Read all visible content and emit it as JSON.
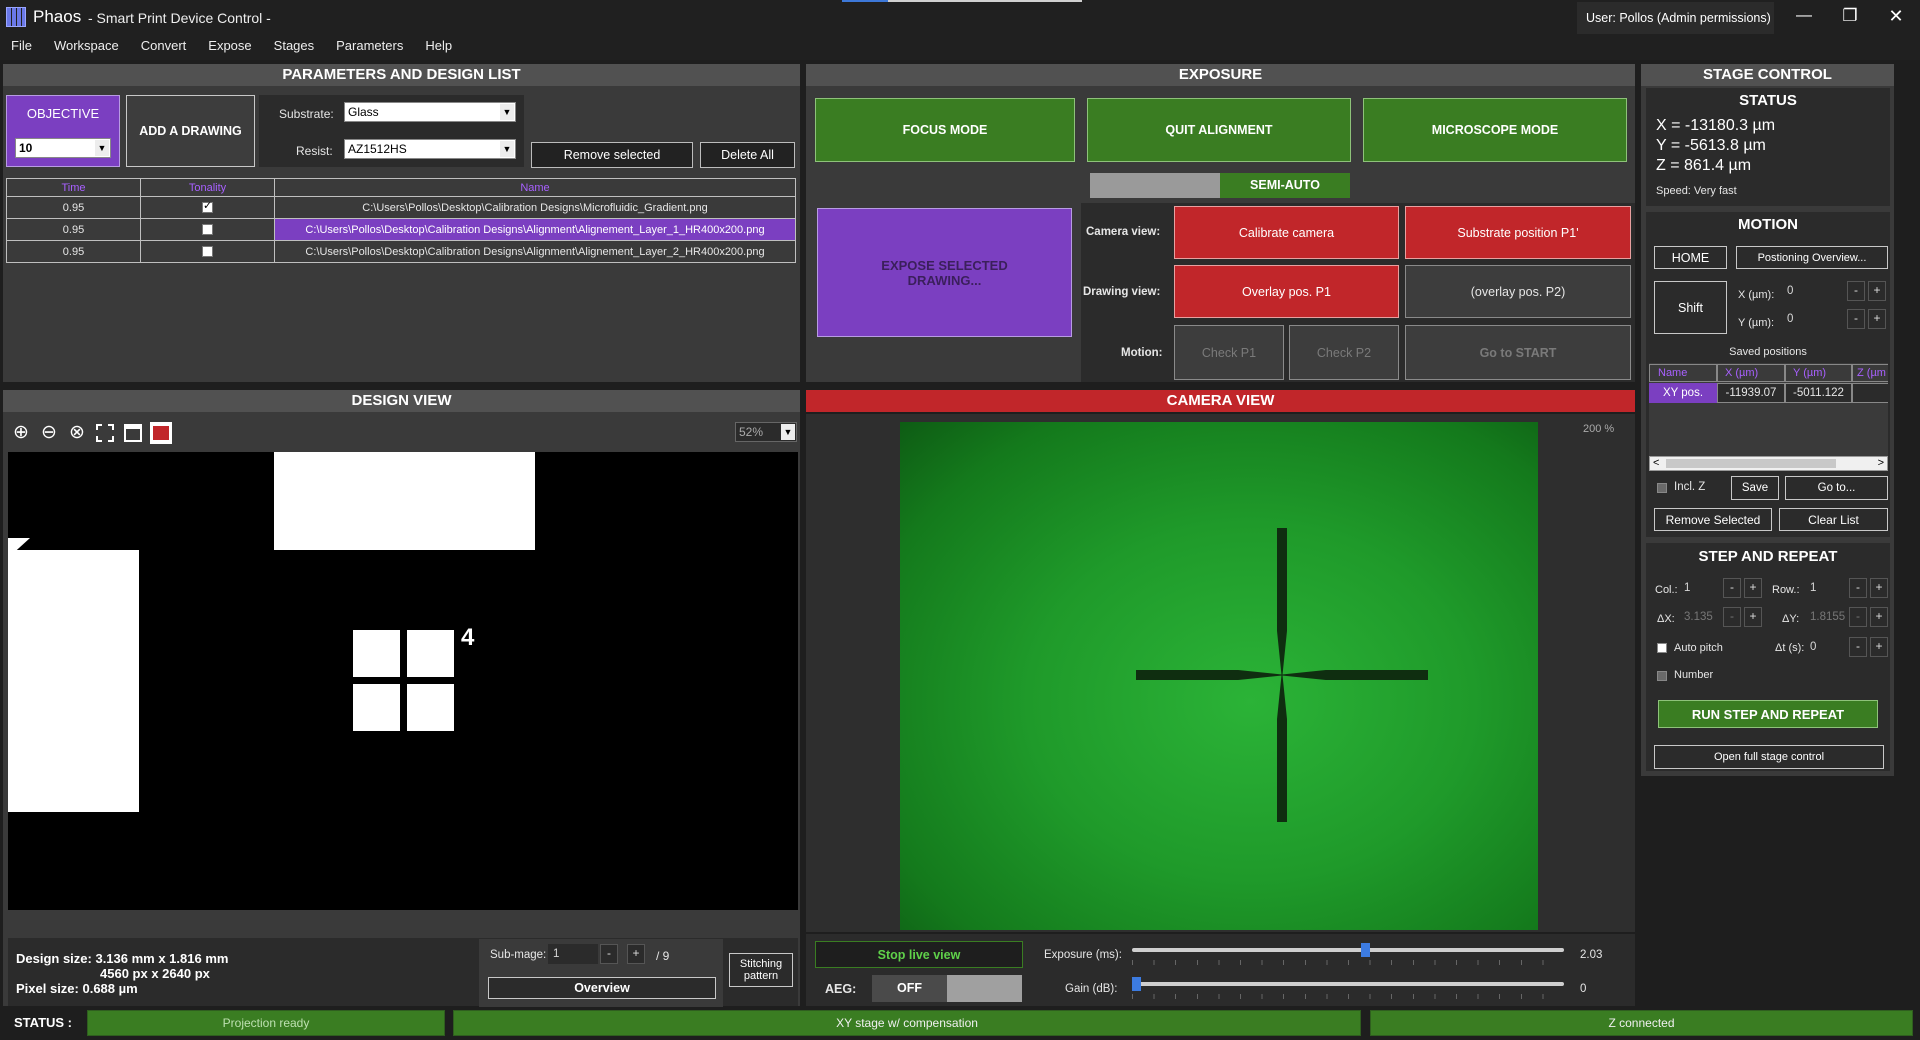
{
  "app": {
    "name": "Phaos",
    "title": "- Smart Print Device Control -",
    "user": "User: Pollos (Admin permissions)",
    "controls": {
      "minimize": "—",
      "maximize": "❐",
      "close": "✕"
    }
  },
  "menu": [
    "File",
    "Workspace",
    "Convert",
    "Expose",
    "Stages",
    "Parameters",
    "Help"
  ],
  "params": {
    "header": "PARAMETERS AND DESIGN LIST",
    "objective_label": "OBJECTIVE",
    "objective_value": "10",
    "add_drawing": "ADD A DRAWING",
    "substrate_label": "Substrate:",
    "substrate_value": "Glass",
    "resist_label": "Resist:",
    "resist_value": "AZ1512HS",
    "remove_selected": "Remove selected",
    "delete_all": "Delete All",
    "columns": [
      "Time",
      "Tonality",
      "Name"
    ],
    "rows": [
      {
        "time": "0.95",
        "tonality": true,
        "name": "C:\\Users\\Pollos\\Desktop\\Calibration Designs\\Microfluidic_Gradient.png",
        "selected": false
      },
      {
        "time": "0.95",
        "tonality": false,
        "name": "C:\\Users\\Pollos\\Desktop\\Calibration Designs\\Alignment\\Alignement_Layer_1_HR400x200.png",
        "selected": true
      },
      {
        "time": "0.95",
        "tonality": false,
        "name": "C:\\Users\\Pollos\\Desktop\\Calibration Designs\\Alignment\\Alignement_Layer_2_HR400x200.png",
        "selected": false
      }
    ]
  },
  "design": {
    "header": "DESIGN VIEW",
    "zoom": "52%",
    "marker": "4",
    "size_label": "Design size: 3.136 mm x 1.816 mm",
    "px_label": "4560 px x 2640 px",
    "pixel_label": "Pixel size: 0.688 µm",
    "subimage_label": "Sub-mage:",
    "subimage_value": "1",
    "subimage_total": "/ 9",
    "overview": "Overview",
    "stitching": "Stitching pattern",
    "minus": "-",
    "plus": "+"
  },
  "exposure": {
    "header": "EXPOSURE",
    "focus": "FOCUS MODE",
    "quit": "QUIT ALIGNMENT",
    "microscope": "MICROSCOPE MODE",
    "semi_auto": "SEMI-AUTO",
    "expose": "EXPOSE SELECTED DRAWING...",
    "camera_view_label": "Camera view:",
    "drawing_view_label": "Drawing view:",
    "motion_label": "Motion:",
    "calibrate": "Calibrate camera",
    "substrate_p1": "Substrate position P1'",
    "overlay_p1": "Overlay pos. P1",
    "overlay_p2": "(overlay pos. P2)",
    "check_p1": "Check P1",
    "check_p2": "Check P2",
    "go_start": "Go to START"
  },
  "camera": {
    "header": "CAMERA VIEW",
    "zoom": "200 %",
    "stop_live": "Stop live view",
    "aeg_label": "AEG:",
    "aeg_state": "OFF",
    "exposure_label": "Exposure (ms):",
    "exposure_value": "2.03",
    "exposure_level": 0.54,
    "gain_label": "Gain (dB):",
    "gain_value": "0",
    "gain_level": 0.0
  },
  "stage": {
    "header": "STAGE CONTROL",
    "status_title": "STATUS",
    "x": "X = -13180.3 µm",
    "y": "Y = -5613.8 µm",
    "z": "Z = 861.4 µm",
    "speed": "Speed: Very fast",
    "motion_title": "MOTION",
    "home": "HOME",
    "positioning": "Postioning Overview...",
    "shift": "Shift",
    "x_label": "X (µm):",
    "x_val": "0",
    "y_label": "Y (µm):",
    "y_val": "0",
    "saved_positions": "Saved positions",
    "saved_cols": [
      "Name",
      "X (µm)",
      "Y (µm)",
      "Z (µm"
    ],
    "saved_row": {
      "name": "XY pos.",
      "x": "-11939.07",
      "y": "-5011.122",
      "z": ""
    },
    "incl_z": "Incl. Z",
    "save": "Save",
    "goto": "Go to...",
    "remove_selected": "Remove Selected",
    "clear_list": "Clear List",
    "sr_title": "STEP AND REPEAT",
    "col_label": "Col.:",
    "col_val": "1",
    "row_label": "Row.:",
    "row_val": "1",
    "dx_label": "ΔX:",
    "dx_val": "3.135",
    "dy_label": "ΔY:",
    "dy_val": "1.8155",
    "auto_pitch": "Auto pitch",
    "dt_label": "Δt (s):",
    "dt_val": "0",
    "number": "Number",
    "run": "RUN STEP AND REPEAT",
    "open_full": "Open full stage control",
    "minus": "-",
    "plus": "+"
  },
  "status": {
    "label": "STATUS :",
    "projection": "Projection ready",
    "xy": "XY stage w/ compensation",
    "z": "Z connected"
  },
  "colors": {
    "accent_purple": "#7b3fc1",
    "green": "#3a7d22",
    "red": "#c1262a"
  }
}
